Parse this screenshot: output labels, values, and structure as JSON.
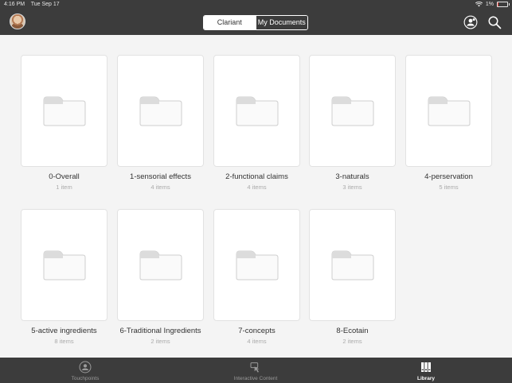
{
  "status_bar": {
    "time": "4:16 PM",
    "date": "Tue Sep 17",
    "battery": "1%",
    "battery_level": 0.1,
    "battery_color": "#e53935"
  },
  "segmented_control": {
    "options": [
      "Clariant",
      "My Documents"
    ],
    "selected": "Clariant"
  },
  "folders": [
    {
      "name": "0-Overall",
      "count": "1 item"
    },
    {
      "name": "1-sensorial effects",
      "count": "4 items"
    },
    {
      "name": "2-functional claims",
      "count": "4 items"
    },
    {
      "name": "3-naturals",
      "count": "3 items"
    },
    {
      "name": "4-perservation",
      "count": "5 items"
    },
    {
      "name": "5-active ingredients",
      "count": "8 items"
    },
    {
      "name": "6-Traditional Ingredients",
      "count": "2 items"
    },
    {
      "name": "7-concepts",
      "count": "4 items"
    },
    {
      "name": "8-Ecotain",
      "count": "2 items"
    }
  ],
  "tab_bar": {
    "tabs": [
      {
        "label": "Touchpoints",
        "icon": "touchpoints-icon"
      },
      {
        "label": "Interactive Content",
        "icon": "interactive-content-icon"
      },
      {
        "label": "Library",
        "icon": "library-icon"
      }
    ],
    "selected": "Library"
  },
  "colors": {
    "bar": "#3c3c3c",
    "background": "#f4f4f4",
    "card": "#ffffff"
  }
}
